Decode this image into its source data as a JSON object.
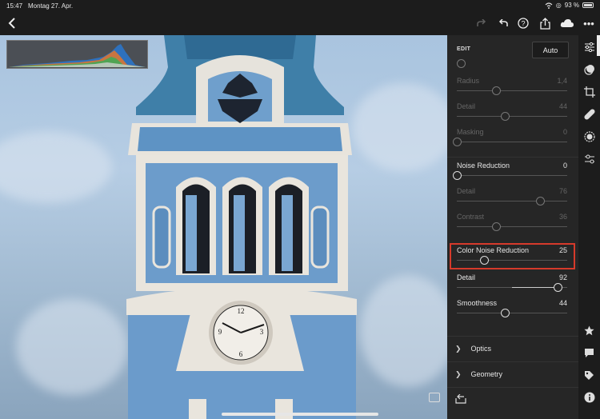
{
  "status": {
    "time": "15:47",
    "date": "Montag 27. Apr.",
    "battery": "93 %"
  },
  "toolbar_icons": [
    "back-chevron-icon",
    "redo-icon",
    "undo-icon",
    "help-icon",
    "share-icon",
    "cloud-sync-icon",
    "more-icon"
  ],
  "panel": {
    "edit_label": "EDIT",
    "auto_label": "Auto",
    "sliders": [
      {
        "label": "Radius",
        "value": "1,4",
        "pos": 0.36,
        "state": "dim"
      },
      {
        "label": "Detail",
        "value": "44",
        "pos": 0.44,
        "state": "dim"
      },
      {
        "label": "Masking",
        "value": "0",
        "pos": 0.0,
        "state": "dim"
      },
      {
        "label": "Noise Reduction",
        "value": "0",
        "pos": 0.0,
        "state": "bright"
      },
      {
        "label": "Detail",
        "value": "76",
        "pos": 0.76,
        "state": "dim"
      },
      {
        "label": "Contrast",
        "value": "36",
        "pos": 0.36,
        "state": "dim"
      },
      {
        "label": "Color Noise Reduction",
        "value": "25",
        "pos": 0.25,
        "state": "bright"
      },
      {
        "label": "Detail",
        "value": "92",
        "pos": 0.92,
        "state": "bright"
      },
      {
        "label": "Smoothness",
        "value": "44",
        "pos": 0.44,
        "state": "bright"
      }
    ],
    "sections": [
      {
        "label": "Optics",
        "icon": "chevron-right-icon"
      },
      {
        "label": "Geometry",
        "icon": "chevron-right-icon"
      }
    ]
  },
  "rail_icons_top": [
    "sliders-icon",
    "color-icon",
    "crop-icon",
    "healing-icon",
    "radial-icon",
    "presets-icon"
  ],
  "rail_icons_bottom": [
    "star-icon",
    "comment-icon",
    "tag-icon",
    "info-icon"
  ],
  "colors": {
    "highlight": "#d63a2b",
    "panel_bg": "#262626"
  }
}
